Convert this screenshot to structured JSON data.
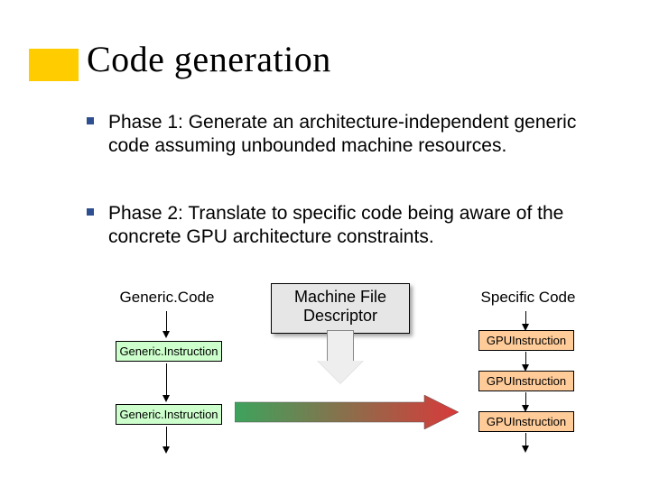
{
  "title": "Code generation",
  "bullets": [
    "Phase 1: Generate an architecture-independent generic code assuming unbounded machine resources.",
    "Phase 2: Translate to specific code being aware of the concrete GPU architecture constraints."
  ],
  "diagram": {
    "col_left_label": "Generic.Code",
    "col_right_label": "Specific Code",
    "machine_file_box": "Machine File Descriptor",
    "generic_instruction": "Generic.Instruction",
    "gpu_instruction": "GPUInstruction"
  },
  "colors": {
    "accent": "#ffcc00",
    "bullet_square": "#2d4f8f",
    "generic_box": "#ccffcc",
    "gpu_box": "#ffcc99",
    "arrow_fill_a": "#3da35d",
    "arrow_fill_b": "#d83a3a"
  }
}
